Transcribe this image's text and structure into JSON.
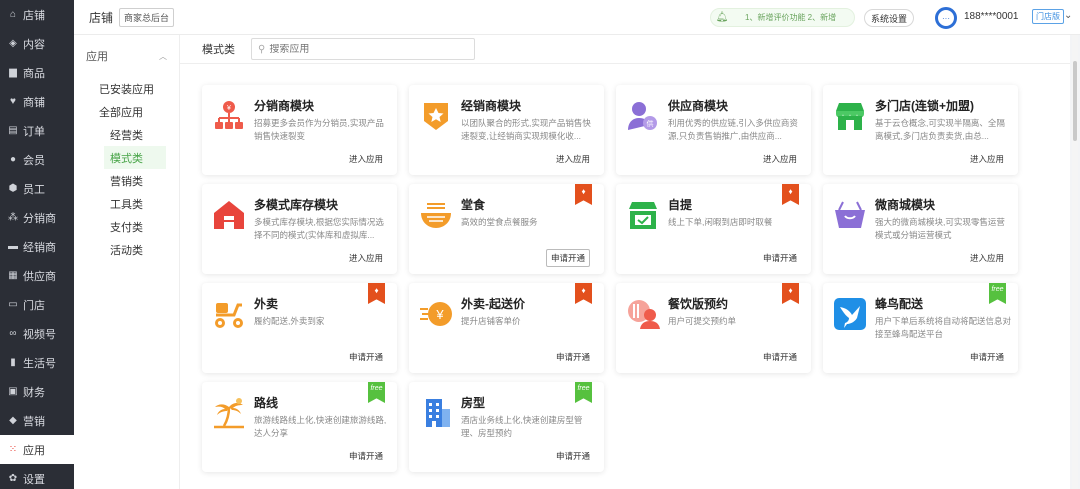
{
  "nav": {
    "items": [
      {
        "label": "店铺",
        "icon": "home-icon"
      },
      {
        "label": "内容",
        "icon": "layers-icon"
      },
      {
        "label": "商品",
        "icon": "product-icon"
      },
      {
        "label": "商铺",
        "icon": "heart-icon"
      },
      {
        "label": "订单",
        "icon": "order-icon"
      },
      {
        "label": "会员",
        "icon": "user-icon"
      },
      {
        "label": "员工",
        "icon": "staff-icon"
      },
      {
        "label": "分销商",
        "icon": "org-icon"
      },
      {
        "label": "经销商",
        "icon": "briefcase-icon"
      },
      {
        "label": "供应商",
        "icon": "box-icon"
      },
      {
        "label": "门店",
        "icon": "store-icon"
      },
      {
        "label": "视频号",
        "icon": "video-icon"
      },
      {
        "label": "生活号",
        "icon": "bookmark-icon"
      },
      {
        "label": "财务",
        "icon": "finance-icon"
      },
      {
        "label": "营销",
        "icon": "tag-icon"
      },
      {
        "label": "应用",
        "icon": "apps-icon"
      },
      {
        "label": "设置",
        "icon": "gear-icon"
      }
    ],
    "active_index": 15
  },
  "header": {
    "title": "店铺",
    "backend_btn": "商家总后台",
    "notice": "1、新增评价功能 2、新增",
    "system_settings": "系统设置",
    "phone": "188****0001",
    "shop_badge": "门店版"
  },
  "subnav": {
    "head": "应用",
    "installed": "已安装应用",
    "all": "全部应用",
    "categories": [
      "经营类",
      "模式类",
      "营销类",
      "工具类",
      "支付类",
      "活动类"
    ],
    "active_category": "模式类"
  },
  "main": {
    "tab_label": "模式类",
    "search_placeholder": "搜索应用"
  },
  "cards": [
    {
      "title": "分销商模块",
      "desc": "招募更多会员作为分销员,实现产品销售快速裂变",
      "action": "进入应用",
      "boxed": false,
      "flag": null,
      "icon": "distributor-icon",
      "color": "#ef5b4b"
    },
    {
      "title": "经销商模块",
      "desc": "以团队聚合的形式,实现产品销售快速裂变,让经销商实现规模化收...",
      "action": "进入应用",
      "boxed": false,
      "flag": null,
      "icon": "dealer-badge-icon",
      "color": "#f39c2a"
    },
    {
      "title": "供应商模块",
      "desc": "利用优秀的供应链,引入多供应商资源,只负责售销推广,由供应商...",
      "action": "进入应用",
      "boxed": false,
      "flag": null,
      "icon": "supplier-icon",
      "color": "#8b6fd6"
    },
    {
      "title": "多门店(连锁+加盟)",
      "desc": "基于云仓概念,可实现半隔离、全隔离模式,多门店负责卖货,由总...",
      "action": "进入应用",
      "boxed": false,
      "flag": null,
      "icon": "storefront-icon",
      "color": "#2db24a"
    },
    {
      "title": "多模式库存模块",
      "desc": "多模式库存模块,根据您实际情况选择不同的模式(实体库和虚拟库...",
      "action": "进入应用",
      "boxed": false,
      "flag": null,
      "icon": "warehouse-icon",
      "color": "#e8453c"
    },
    {
      "title": "堂食",
      "desc": "高效的堂食点餐服务",
      "action": "申请开通",
      "boxed": true,
      "flag": "red",
      "icon": "bowl-icon",
      "color": "#f39c2a"
    },
    {
      "title": "自提",
      "desc": "线上下单,闲暇到店即时取餐",
      "action": "申请开通",
      "boxed": false,
      "flag": "red",
      "icon": "pickup-store-icon",
      "color": "#2db24a"
    },
    {
      "title": "微商城模块",
      "desc": "强大的微商城模块,可实现零售运营模式或分销运营模式",
      "action": "进入应用",
      "boxed": false,
      "flag": null,
      "icon": "basket-icon",
      "color": "#8b6fd6"
    },
    {
      "title": "外卖",
      "desc": "履约配送,外卖到家",
      "action": "申请开通",
      "boxed": false,
      "flag": "red",
      "icon": "scooter-icon",
      "color": "#f39c2a"
    },
    {
      "title": "外卖-起送价",
      "desc": "提升店铺客单价",
      "action": "申请开通",
      "boxed": false,
      "flag": "red",
      "icon": "yen-coin-icon",
      "color": "#f39c2a"
    },
    {
      "title": "餐饮版预约",
      "desc": "用户可提交预约单",
      "action": "申请开通",
      "boxed": false,
      "flag": "red",
      "icon": "reservation-icon",
      "color": "#ef5b4b"
    },
    {
      "title": "蜂鸟配送",
      "desc": "用户下单后系统将自动将配送信息对接至蜂鸟配送平台",
      "action": "申请开通",
      "boxed": false,
      "flag": "green",
      "icon": "hummingbird-icon",
      "color": "#1f8fe6"
    },
    {
      "title": "路线",
      "desc": "旅游线路线上化,快速创建旅游线路,达人分享",
      "action": "申请开通",
      "boxed": false,
      "flag": "green",
      "icon": "palm-tree-icon",
      "color": "#f39c2a"
    },
    {
      "title": "房型",
      "desc": "酒店业务线上化,快速创建房型管理、房型预约",
      "action": "申请开通",
      "boxed": false,
      "flag": "green",
      "icon": "hotel-icon",
      "color": "#3a7fe0"
    }
  ],
  "flag_texts": {
    "red": "♦",
    "green": "free"
  }
}
